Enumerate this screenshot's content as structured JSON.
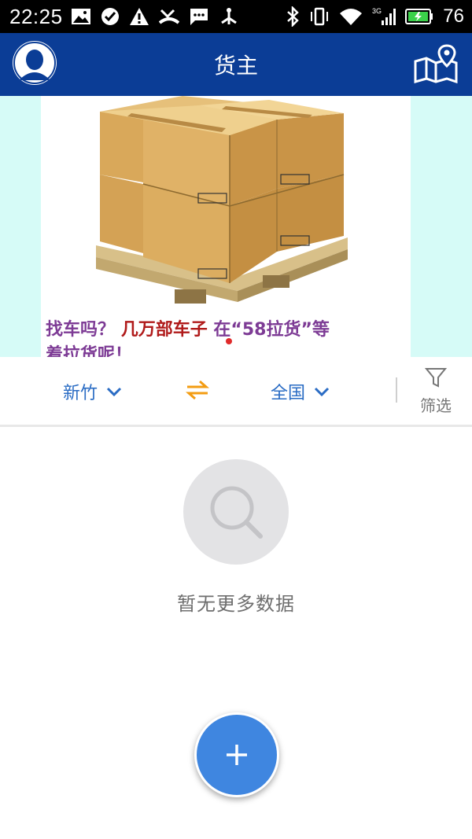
{
  "status_bar": {
    "time": "22:25",
    "battery": "76",
    "network": "3G",
    "icons": [
      "image-icon",
      "check-circle-icon",
      "warning-icon",
      "missed-call-icon",
      "sms-icon",
      "usb-icon",
      "bluetooth-icon",
      "vibrate-icon",
      "wifi-icon",
      "signal-icon",
      "battery-icon"
    ]
  },
  "appbar": {
    "title": "货主",
    "left_icon": "user-avatar-icon",
    "right_icon": "map-pin-icon"
  },
  "banner": {
    "caption_part1": "找车吗？",
    "caption_part2": "几万部车子",
    "caption_part3": "在“58拉货”等",
    "caption_line2": "着拉货呢！",
    "caption_color": "#7d3b95",
    "highlight_color": "#b01a1a"
  },
  "filter": {
    "from": "新竹",
    "to": "全国",
    "filter_label": "筛选",
    "accent_color": "#2a6cc4",
    "swap_color": "#f39c12"
  },
  "empty_state": {
    "message": "暂无更多数据",
    "icon": "search-icon"
  },
  "fab": {
    "icon": "plus-icon",
    "color": "#3f86e0"
  },
  "colors": {
    "appbar": "#0b3d96",
    "banner_bg": "#d6fbf7"
  }
}
